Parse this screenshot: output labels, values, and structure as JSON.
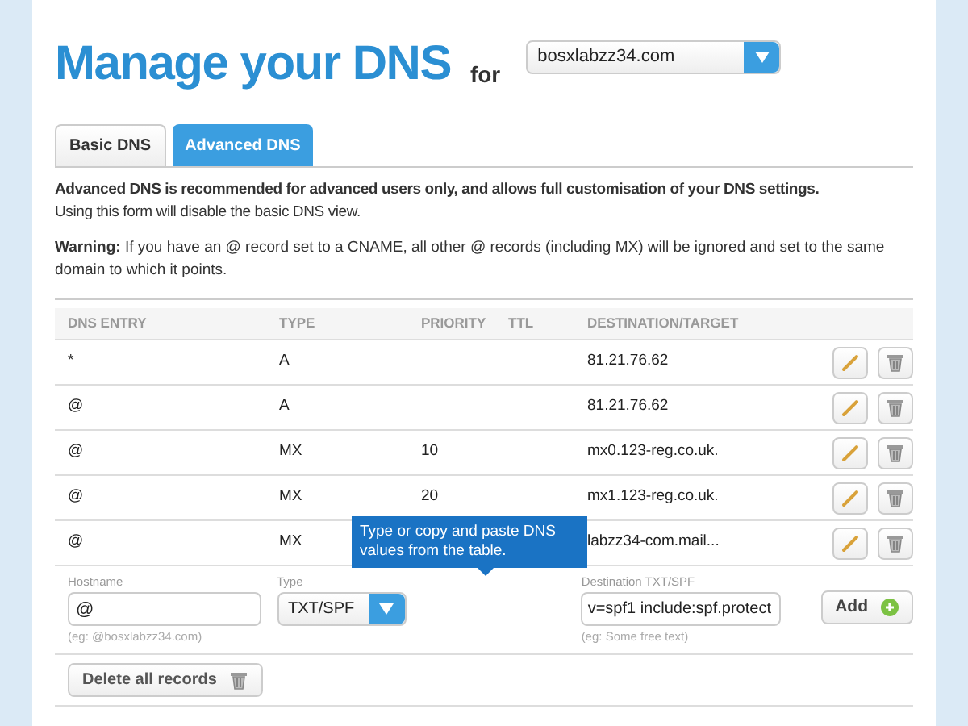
{
  "header": {
    "title": "Manage your DNS",
    "for_label": "for",
    "domain": "bosxlabzz34.com"
  },
  "tabs": [
    {
      "label": "Basic DNS",
      "selected": false
    },
    {
      "label": "Advanced DNS",
      "selected": true
    }
  ],
  "intro": {
    "bold": "Advanced DNS is recommended for advanced users only, and allows full customisation of your DNS settings.",
    "text": "Using this form will disable the basic DNS view."
  },
  "warning": "**Warning:** If you have an @ record set to a CNAME, all other @ records (including MX) will be ignored and set to the same domain to which it points.",
  "table": {
    "columns": [
      "DNS ENTRY",
      "TYPE",
      "PRIORITY",
      "TTL",
      "DESTINATION/TARGET"
    ],
    "rows": [
      {
        "entry": "*",
        "type": "A",
        "priority": "",
        "destination": "81.21.76.62"
      },
      {
        "entry": "@",
        "type": "A",
        "priority": "",
        "destination": "81.21.76.62"
      },
      {
        "entry": "@",
        "type": "MX",
        "priority": "10",
        "destination": "mx0.123-reg.co.uk."
      },
      {
        "entry": "@",
        "type": "MX",
        "priority": "20",
        "destination": "mx1.123-reg.co.uk."
      },
      {
        "entry": "@",
        "type": "MX",
        "priority": "",
        "destination": "labzz34-com.mail..."
      }
    ]
  },
  "form": {
    "hostname": {
      "label": "Hostname",
      "value": "@",
      "hint": "(eg: @bosxlabzz34.com)"
    },
    "type": {
      "label": "Type",
      "value": "TXT/SPF"
    },
    "destination": {
      "label": "Destination TXT/SPF",
      "value": "v=spf1 include:spf.protect",
      "hint": "(eg: Some free text)"
    },
    "add_button": "Add"
  },
  "delete_all_button": "Delete all records",
  "tooltip": "Type or copy and paste DNS values from the table."
}
